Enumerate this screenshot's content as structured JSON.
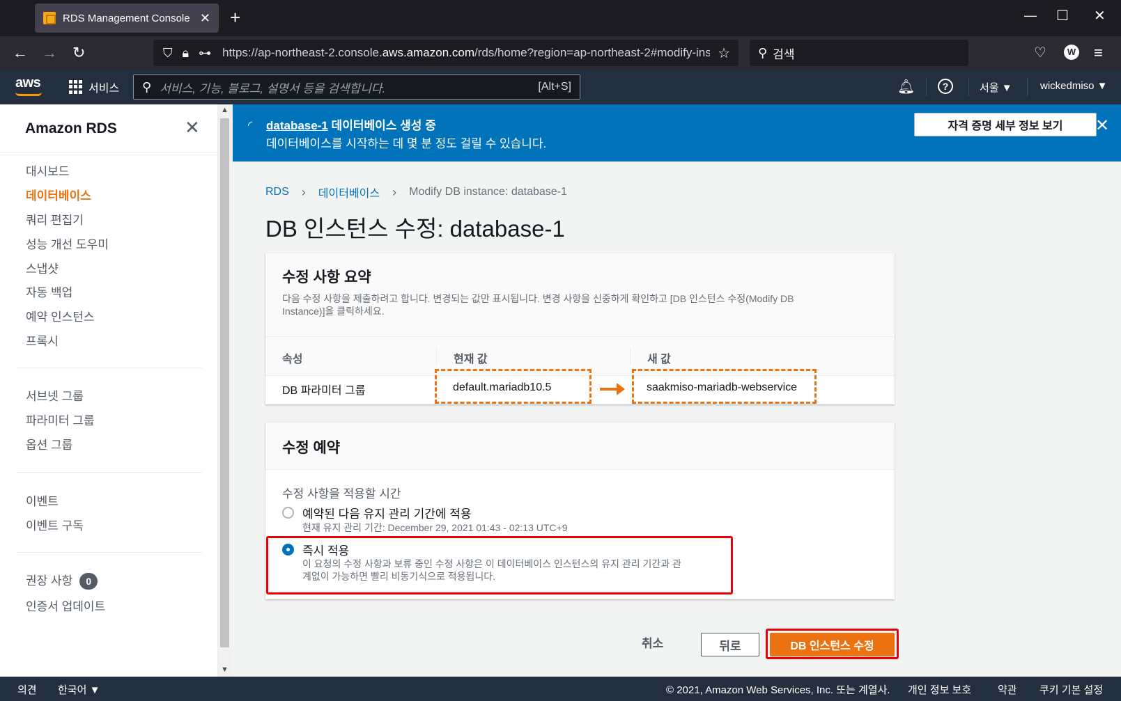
{
  "browser": {
    "tab_title": "RDS Management Console",
    "url_prefix": "https://ap-northeast-2.console.",
    "url_domain": "aws.amazon.com",
    "url_rest": "/rds/home?region=ap-northeast-2#modify-ins",
    "search_placeholder": "검색",
    "profile_initial": "W"
  },
  "aws_header": {
    "logo": "aws",
    "services_label": "서비스",
    "search_placeholder": "서비스, 기능, 블로그, 설명서 등을 검색합니다.",
    "search_shortcut": "[Alt+S]",
    "region": "서울 ▼",
    "account": "wickedmiso ▼"
  },
  "sidebar": {
    "title": "Amazon RDS",
    "group1": [
      "대시보드",
      "데이터베이스",
      "쿼리 편집기",
      "성능 개선 도우미",
      "스냅샷",
      "자동 백업",
      "예약 인스턴스",
      "프록시"
    ],
    "group2": [
      "서브넷 그룹",
      "파라미터 그룹",
      "옵션 그룹"
    ],
    "group3": [
      "이벤트",
      "이벤트 구독"
    ],
    "group4_recommend": "권장 사항",
    "group4_recommend_count": "0",
    "group4_cert": "인증서 업데이트",
    "active_item": "데이터베이스"
  },
  "banner": {
    "db_link": "database-1",
    "title_rest": " 데이터베이스 생성 중",
    "message": "데이터베이스를 시작하는 데 몇 분 정도 걸릴 수 있습니다.",
    "button": "자격 증명 세부 정보 보기",
    "bg_color": "#0073bb"
  },
  "breadcrumb": {
    "items": [
      "RDS",
      "데이터베이스",
      "Modify DB instance: database-1"
    ]
  },
  "page_title": "DB 인스턴스 수정: database-1",
  "summary": {
    "title": "수정 사항 요약",
    "desc1": "다음 수정 사항을 제출하려고 합니다. 변경되는 값만 표시됩니다. 변경 사항을 신중하게 확인하고 [DB 인스턴스 수정(Modify DB",
    "desc2": "Instance)]을 클릭하세요.",
    "col_attr": "속성",
    "col_current": "현재 값",
    "col_new": "새 값",
    "row_attr": "DB 파라미터 그룹",
    "row_current": "default.mariadb10.5",
    "row_new": "saakmiso-mariadb-webservice"
  },
  "schedule": {
    "title": "수정 예약",
    "label": "수정 사항을 적용할 시간",
    "opt1_label": "예약된 다음 유지 관리 기간에 적용",
    "opt1_desc": "현재 유지 관리 기간: December 29, 2021 01:43 - 02:13 UTC+9",
    "opt2_label": "즉시 적용",
    "opt2_desc1": "이 요청의 수정 사항과 보류 중인 수정 사항은 이 데이터베이스 인스턴스의 유지 관리 기간과 관",
    "opt2_desc2": "계없이 가능하면 빨리 비동기식으로 적용됩니다.",
    "selected": "즉시 적용"
  },
  "actions": {
    "cancel": "취소",
    "back": "뒤로",
    "submit": "DB 인스턴스 수정",
    "accent": "#ec7211"
  },
  "footer": {
    "feedback": "의견",
    "language": "한국어 ▼",
    "copyright": "© 2021, Amazon Web Services, Inc. 또는 계열사.",
    "privacy": "개인 정보 보호",
    "terms": "약관",
    "cookies": "쿠키 기본 설정"
  }
}
